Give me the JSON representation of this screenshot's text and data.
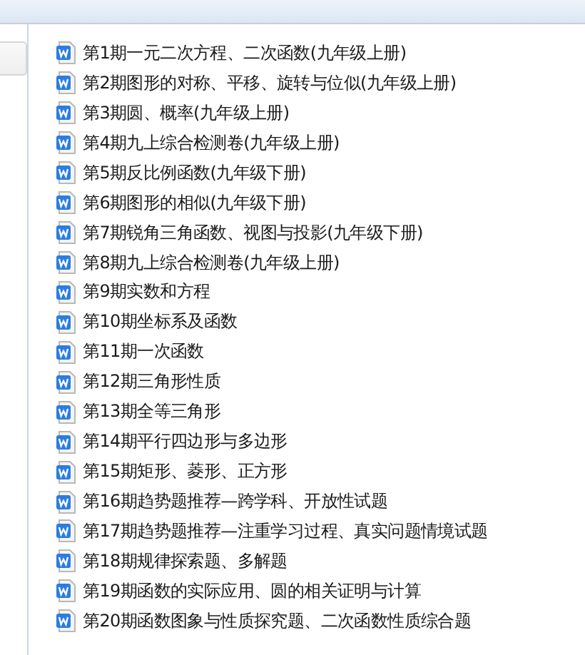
{
  "files": [
    {
      "name": "第1期一元二次方程、二次函数(九年级上册)"
    },
    {
      "name": "第2期图形的对称、平移、旋转与位似(九年级上册)"
    },
    {
      "name": "第3期圆、概率(九年级上册)"
    },
    {
      "name": "第4期九上综合检测卷(九年级上册)"
    },
    {
      "name": "第5期反比例函数(九年级下册)"
    },
    {
      "name": "第6期图形的相似(九年级下册)"
    },
    {
      "name": "第7期锐角三角函数、视图与投影(九年级下册)"
    },
    {
      "name": "第8期九上综合检测卷(九年级上册)"
    },
    {
      "name": "第9期实数和方程"
    },
    {
      "name": "第10期坐标系及函数"
    },
    {
      "name": "第11期一次函数"
    },
    {
      "name": "第12期三角形性质"
    },
    {
      "name": "第13期全等三角形"
    },
    {
      "name": "第14期平行四边形与多边形"
    },
    {
      "name": "第15期矩形、菱形、正方形"
    },
    {
      "name": "第16期趋势题推荐—跨学科、开放性试题"
    },
    {
      "name": "第17期趋势题推荐—注重学习过程、真实问题情境试题"
    },
    {
      "name": "第18期规律探索题、多解题"
    },
    {
      "name": "第19期函数的实际应用、圆的相关证明与计算"
    },
    {
      "name": "第20期函数图象与性质探究题、二次函数性质综合题"
    }
  ]
}
